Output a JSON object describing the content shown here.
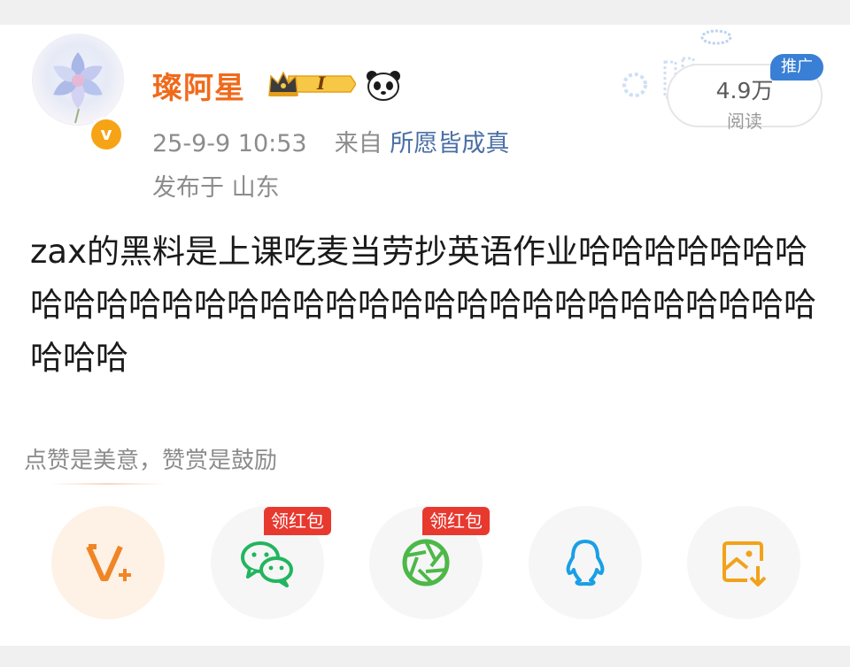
{
  "post": {
    "author": "璨阿星",
    "level_badge": "I",
    "timestamp": "25-9-9 10:53",
    "from_label": "来自",
    "source": "所愿皆成真",
    "location_label": "发布于",
    "location": "山东",
    "verified_mark": "v",
    "reads": {
      "count": "4.9万",
      "label": "阅读"
    },
    "promo_tag": "推广",
    "text": "zax的黑料是上课吃麦当劳抄英语作业哈哈哈哈哈哈哈哈哈哈哈哈哈哈哈哈哈哈哈哈哈哈哈哈哈哈哈哈哈哈哈哈哈哈"
  },
  "appreciate": {
    "text": "点赞是美意，赞赏是鼓励"
  },
  "share": {
    "items": [
      {
        "icon": "v-plus-icon"
      },
      {
        "icon": "wechat-icon",
        "badge": "领红包"
      },
      {
        "icon": "moments-icon",
        "badge": "领红包"
      },
      {
        "icon": "qq-icon"
      },
      {
        "icon": "save-image-icon"
      }
    ]
  },
  "colors": {
    "username": "#f06a1b",
    "source_link": "#4a6fa5",
    "promo": "#3a7fd6",
    "redpack": "#e8392f",
    "wechat": "#22b55f",
    "moments": "#4cb848",
    "qq": "#1a9fe6",
    "save": "#f2a21a",
    "v_plus": "#f08525"
  }
}
